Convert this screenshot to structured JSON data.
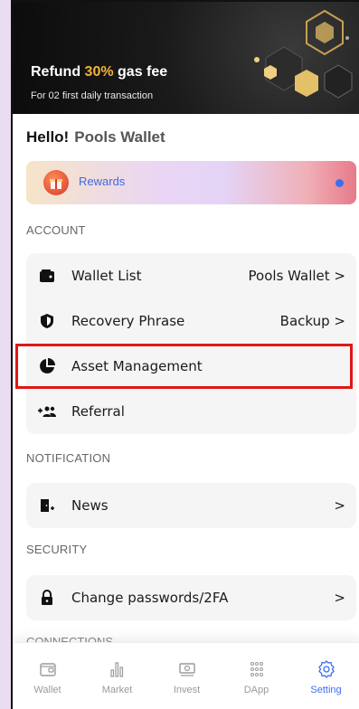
{
  "banner": {
    "title_prefix": "Refund ",
    "title_highlight": "30%",
    "title_suffix": " gas fee",
    "subtitle": "For 02 first daily transaction"
  },
  "greeting": {
    "hello": "Hello!",
    "wallet_name": "Pools Wallet"
  },
  "rewards": {
    "label": "Rewards"
  },
  "sections": {
    "account": "ACCOUNT",
    "notification": "NOTIFICATION",
    "security": "SECURITY",
    "connections": "CONNECTIONS"
  },
  "account_items": [
    {
      "label": "Wallet List",
      "value": "Pools Wallet >"
    },
    {
      "label": "Recovery Phrase",
      "value": "Backup >"
    },
    {
      "label": "Asset Management",
      "value": ""
    },
    {
      "label": "Referral",
      "value": ""
    }
  ],
  "notification_items": [
    {
      "label": "News",
      "value": ">"
    }
  ],
  "security_items": [
    {
      "label": "Change passwords/2FA",
      "value": ">"
    }
  ],
  "bottom_nav": [
    {
      "label": "Wallet",
      "icon": "wallet-icon"
    },
    {
      "label": "Market",
      "icon": "chart-icon"
    },
    {
      "label": "Invest",
      "icon": "money-icon"
    },
    {
      "label": "DApp",
      "icon": "grid-dots-icon"
    },
    {
      "label": "Setting",
      "icon": "gear-icon"
    }
  ],
  "colors": {
    "accent": "#3a6ff0",
    "highlight_border": "#e01616",
    "banner_highlight": "#f3b23a"
  }
}
